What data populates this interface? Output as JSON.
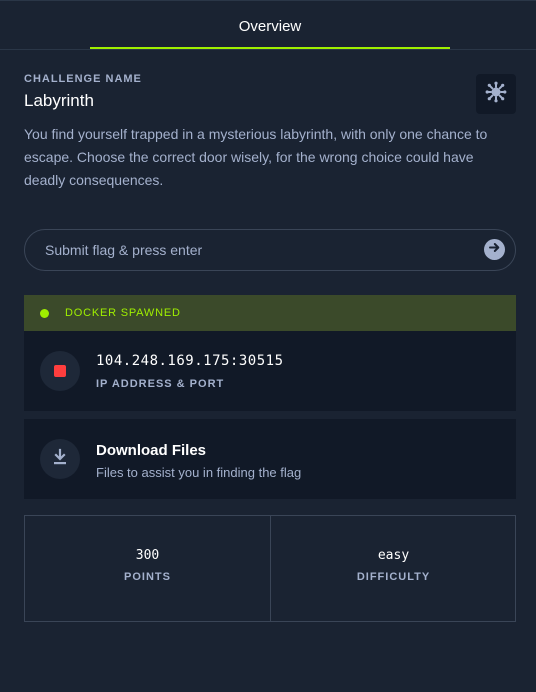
{
  "tabs": [
    {
      "label": "Overview",
      "active": true
    }
  ],
  "challenge": {
    "name_label": "CHALLENGE NAME",
    "name": "Labyrinth",
    "category_icon": "brain-icon",
    "description": "You find yourself trapped in a mysterious labyrinth, with only one chance to escape. Choose the correct door wisely, for the wrong choice could have deadly consequences."
  },
  "flag": {
    "placeholder": "Submit flag & press enter",
    "value": "",
    "submit_icon": "arrow-right-icon"
  },
  "docker": {
    "status": "DOCKER SPAWNED",
    "status_color": "#9fef00",
    "ip_port": "104.248.169.175:30515",
    "ip_caption": "IP ADDRESS & PORT",
    "stop_icon": "stop-icon",
    "stop_color": "#ff3e3e"
  },
  "download": {
    "title": "Download Files",
    "subtitle": "Files to assist you in finding the flag",
    "icon": "download-icon"
  },
  "stats": {
    "points_value": "300",
    "points_label": "POINTS",
    "difficulty_value": "easy",
    "difficulty_label": "DIFFICULTY"
  },
  "colors": {
    "background": "#1a2332",
    "card": "#111927",
    "accent": "#9fef00",
    "muted_text": "#a4b1cd"
  }
}
